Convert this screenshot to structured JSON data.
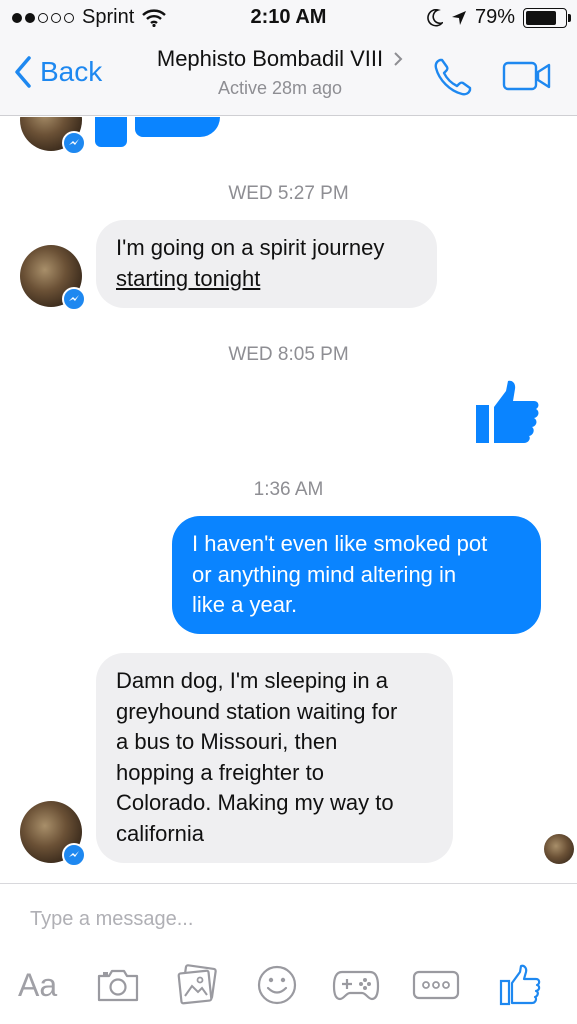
{
  "status_bar": {
    "carrier": "Sprint",
    "time": "2:10 AM",
    "battery": "79%",
    "battery_level": 0.79,
    "signal_bars_filled": 2,
    "signal_bars_total": 5
  },
  "header": {
    "back_label": "Back",
    "contact_name": "Mephisto Bombadil VIII",
    "contact_status": "Active 28m ago",
    "icons": [
      "chevron-left-icon",
      "chevron-right-icon",
      "phone-icon",
      "video-camera-icon"
    ],
    "accent_color": "#1e88f0"
  },
  "conversation": {
    "timestamps": [
      "WED 5:27 PM",
      "WED 8:05 PM",
      "1:36 AM"
    ],
    "messages": [
      {
        "direction": "incoming",
        "lines": [
          "I'm going on a spirit journey",
          "starting tonight"
        ]
      },
      {
        "direction": "outgoing",
        "type": "like-sticker"
      },
      {
        "direction": "outgoing",
        "lines": [
          "I haven't even like smoked pot",
          "or anything mind altering in",
          "like a year."
        ]
      },
      {
        "direction": "incoming",
        "lines": [
          "Damn dog, I'm sleeping in a",
          "greyhound station waiting for",
          "a bus to Missouri, then",
          "hopping a freighter to",
          "Colorado. Making my way to",
          "california"
        ]
      }
    ],
    "outgoing_color": "#0a84ff",
    "incoming_color": "#efeff1"
  },
  "composer": {
    "placeholder": "Type a message...",
    "aa_label": "Aa",
    "tools": [
      "text-style-icon",
      "camera-icon",
      "photo-gallery-icon",
      "emoji-icon",
      "game-controller-icon",
      "more-icon",
      "like-icon"
    ]
  }
}
